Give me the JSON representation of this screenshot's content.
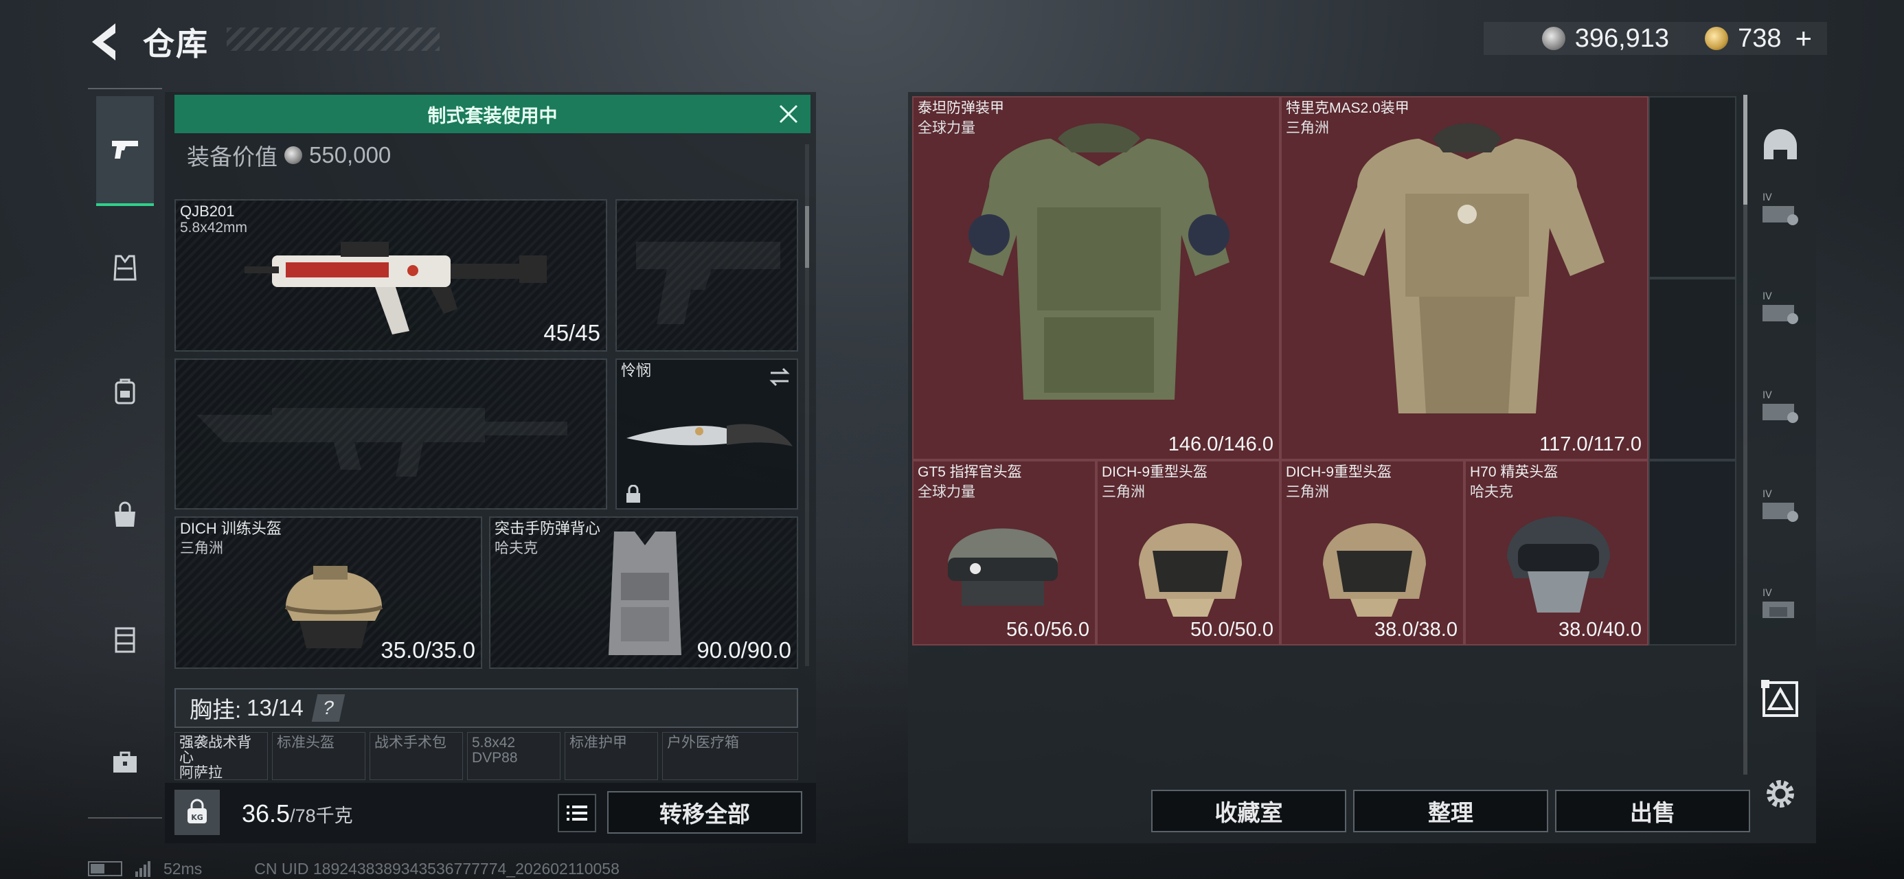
{
  "header": {
    "title": "仓库",
    "silver_amount": "396,913",
    "gold_amount": "738",
    "plus_label": "+"
  },
  "left_nav": {
    "items": [
      {
        "id": "weapons",
        "icon": "pistol-icon",
        "active": true
      },
      {
        "id": "armor",
        "icon": "vest-icon"
      },
      {
        "id": "backpack",
        "icon": "backpack-icon"
      },
      {
        "id": "bag",
        "icon": "bag-icon"
      },
      {
        "id": "container",
        "icon": "case-icon"
      },
      {
        "id": "tools",
        "icon": "toolbox-icon"
      }
    ]
  },
  "loadout": {
    "banner": "制式套装使用中",
    "equip_value_label": "装备价值",
    "equip_value": "550,000",
    "primary": {
      "name": "QJB201",
      "ammo": "5.8x42mm",
      "durability": "45/45"
    },
    "knife": {
      "name": "怜悯"
    },
    "helmet": {
      "name": "DICH 训练头盔",
      "maker": "三角洲",
      "durability": "35.0/35.0"
    },
    "armor": {
      "name": "突击手防弹背心",
      "maker": "哈夫克",
      "durability": "90.0/90.0"
    },
    "chest_rig": {
      "label": "胸挂:",
      "count": "13/14",
      "help": "?"
    },
    "chest_slots": [
      {
        "line1": "强袭战术背心",
        "line2": "阿萨拉",
        "filled": true
      },
      {
        "line1": "标准头盔",
        "line2": "",
        "filled": false
      },
      {
        "line1": "战术手术包",
        "line2": "",
        "filled": false
      },
      {
        "line1": "5.8x42",
        "line2": "DVP88",
        "filled": false
      },
      {
        "line1": "标准护甲",
        "line2": "",
        "filled": false
      },
      {
        "line1": "户外医疗箱",
        "line2": "",
        "filled": false
      }
    ],
    "weight": {
      "current": "36.5",
      "max": "/78千克"
    },
    "kg_badge": "KG",
    "transfer_all": "转移全部"
  },
  "storage": {
    "armors": [
      {
        "name": "泰坦防弹装甲",
        "maker": "全球力量",
        "durability": "146.0/146.0"
      },
      {
        "name": "特里克MAS2.0装甲",
        "maker": "三角洲",
        "durability": "117.0/117.0"
      }
    ],
    "helmets": [
      {
        "name": "GT5 指挥官头盔",
        "maker": "全球力量",
        "durability": "56.0/56.0"
      },
      {
        "name": "DICH-9重型头盔",
        "maker": "三角洲",
        "durability": "50.0/50.0"
      },
      {
        "name": "DICH-9重型头盔",
        "maker": "三角洲",
        "durability": "38.0/38.0"
      },
      {
        "name": "H70 精英头盔",
        "maker": "哈夫克",
        "durability": "38.0/40.0"
      }
    ],
    "buttons": {
      "collection": "收藏室",
      "organize": "整理",
      "sell": "出售"
    }
  },
  "right_filters": {
    "tier_label": "IV",
    "items": [
      "helmet-filter-icon",
      "tier-iv-icon",
      "tier-iv-icon",
      "tier-iv-icon",
      "tier-iv-icon",
      "tier-iv-icon",
      "tier-filter-active-icon",
      "settings-gear-icon"
    ]
  },
  "status": {
    "ping": "52ms",
    "uid": "CN UID 1892438389343536777774_202602110058"
  },
  "colors": {
    "accent_green": "#1b7b5a",
    "storage_cell_red": "#5c2a30",
    "active_nav_underline": "#2fd08a"
  }
}
